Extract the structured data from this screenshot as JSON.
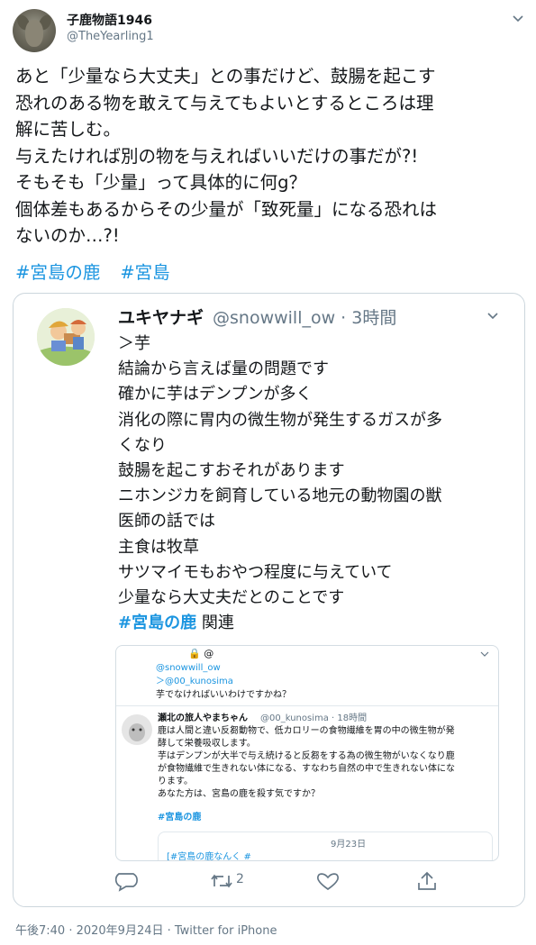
{
  "author": {
    "name": "子鹿物語1946",
    "handle": "@TheYearling1"
  },
  "tweet_lines": [
    "あと「少量なら大丈夫」との事だけど、鼓腸を起こす",
    "恐れのある物を敢えて与えてもよいとするところは理",
    "解に苦しむ。",
    "与えたければ別の物を与えればいいだけの事だが?!",
    "そもそも「少量」って具体的に何g？",
    "個体差もあるからその少量が「致死量」になる恐れは",
    "ないのか…?!"
  ],
  "hashtags": [
    "#宮島の鹿",
    "#宮島"
  ],
  "quoted": {
    "name": "ユキヤナギ",
    "handle_time": "@snowwill_ow · 3時間",
    "lines": [
      "＞芋",
      "結論から言えば量の問題です",
      "確かに芋はデンプンが多く",
      "消化の際に胃内の微生物が発生するガスが多",
      "くなり",
      "鼓腸を起こすおそれがあります",
      "ニホンジカを飼育している地元の動物園の獣",
      "医師の話では",
      "主食は牧草",
      "サツマイモもおやつ程度に与えていて",
      "少量なら大丈夫だとのことです"
    ],
    "hashtag": "#宮島の鹿",
    "hashtag_suffix": " 関連"
  },
  "inner": {
    "lock": "🔒 @",
    "line1": "@snowwill_ow",
    "line2": "＞@00_kunosima",
    "line3": "芋でなければいいわけですかね？",
    "reply_name": "瀬北の旅人やまちゃん",
    "reply_handle": "@00_kunosima · 18時間",
    "reply_lines": [
      "鹿は人間と違い反芻動物で、低カロリーの食物繊維を胃の中の微生物が発",
      "酵して栄養吸収します。",
      "芋はデンプンが大半で与え続けると反芻をする為の微生物がいなくなり鹿",
      "が食物繊維で生きれない体になる、すなわち自然の中で生きれない体にな",
      "ります。",
      "あなた方は、宮島の鹿を殺す気ですか？"
    ],
    "reply_hashtag": "#宮島の鹿",
    "date": "9月23日",
    "cut_line": "[#宮島の鹿なんく #"
  },
  "actions": {
    "retweet_count": "2"
  },
  "meta": "午後7:40 · 2020年9月24日 · Twitter for iPhone",
  "colors": {
    "link": "#1b95e0",
    "secondary": "#657786",
    "border": "#ccd6dd"
  },
  "icons": [
    "chevron-down-icon",
    "reply-icon",
    "retweet-icon",
    "like-icon",
    "share-icon",
    "lock-icon"
  ]
}
